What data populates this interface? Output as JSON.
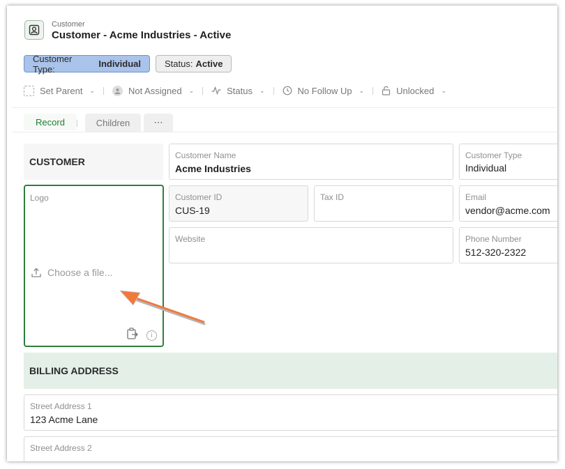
{
  "header": {
    "breadcrumb": "Customer",
    "title": "Customer - Acme Industries - Active"
  },
  "chips": {
    "type_label": "Customer Type:",
    "type_value": "Individual",
    "status_label": "Status:",
    "status_value": "Active"
  },
  "toolbar": {
    "set_parent": "Set Parent",
    "assignee": "Not Assigned",
    "status": "Status",
    "follow_up": "No Follow Up",
    "lock": "Unlocked"
  },
  "tabs": {
    "record": "Record",
    "children": "Children",
    "more": "⋯"
  },
  "sections": {
    "customer": "CUSTOMER",
    "billing": "BILLING ADDRESS"
  },
  "fields": {
    "customer_name": {
      "label": "Customer Name",
      "value": "Acme Industries"
    },
    "customer_type": {
      "label": "Customer Type",
      "value": "Individual"
    },
    "customer_id": {
      "label": "Customer ID",
      "value": "CUS-19"
    },
    "tax_id": {
      "label": "Tax ID",
      "value": ""
    },
    "email": {
      "label": "Email",
      "value": "vendor@acme.com"
    },
    "website": {
      "label": "Website",
      "value": ""
    },
    "phone": {
      "label": "Phone Number",
      "value": "512-320-2322"
    },
    "street1": {
      "label": "Street Address 1",
      "value": "123 Acme Lane"
    },
    "street2": {
      "label": "Street Address 2",
      "value": ""
    }
  },
  "logo": {
    "label": "Logo",
    "upload_text": "Choose a file..."
  },
  "colors": {
    "accent_green": "#2f7d3e",
    "chip_blue": "#a9c3ea",
    "billing_bg": "#e4f0e7",
    "arrow": "#f07a3c"
  }
}
